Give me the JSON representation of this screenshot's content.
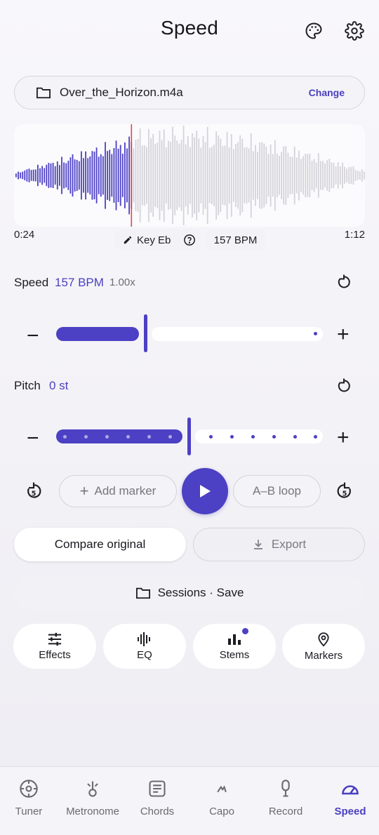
{
  "header": {
    "title": "Speed",
    "palette_icon": "palette-icon",
    "settings_icon": "gear-icon"
  },
  "file": {
    "name": "Over_the_Horizon.m4a",
    "change_label": "Change",
    "icon": "folder-icon"
  },
  "waveform": {
    "current_time": "0:24",
    "total_time": "1:12",
    "played_fraction": 0.333,
    "key_label": "Key Eb",
    "bpm_chip": "157 BPM",
    "colors": {
      "played": "#4c40c4",
      "unplayed": "#d4d3d8",
      "playhead": "#e8444c"
    }
  },
  "speed": {
    "label": "Speed",
    "value": "157 BPM",
    "factor": "1.00x",
    "level": 0.33,
    "minus": "−",
    "plus": "+"
  },
  "pitch": {
    "label": "Pitch",
    "value": "0 st",
    "level": 0.5,
    "minus": "−",
    "plus": "+"
  },
  "transport": {
    "add_marker": "Add marker",
    "ab_loop": "A–B loop",
    "rewind_icon": "rewind-5-icon",
    "forward_icon": "forward-5-icon",
    "play_icon": "play-icon"
  },
  "actions": {
    "compare": "Compare original",
    "export": "Export",
    "sessions": "Sessions · Save"
  },
  "tools": [
    {
      "label": "Effects",
      "icon": "sliders-icon"
    },
    {
      "label": "EQ",
      "icon": "equalizer-icon"
    },
    {
      "label": "Stems",
      "icon": "bar-chart-icon",
      "badge": true
    },
    {
      "label": "Markers",
      "icon": "map-pin-icon"
    }
  ],
  "nav": [
    {
      "label": "Tuner",
      "icon": "tuner-icon"
    },
    {
      "label": "Metronome",
      "icon": "metronome-icon"
    },
    {
      "label": "Chords",
      "icon": "chords-icon"
    },
    {
      "label": "Capo",
      "icon": "capo-icon"
    },
    {
      "label": "Record",
      "icon": "microphone-icon"
    },
    {
      "label": "Speed",
      "icon": "speedometer-icon",
      "active": true
    }
  ],
  "accent": "#4c40c4"
}
